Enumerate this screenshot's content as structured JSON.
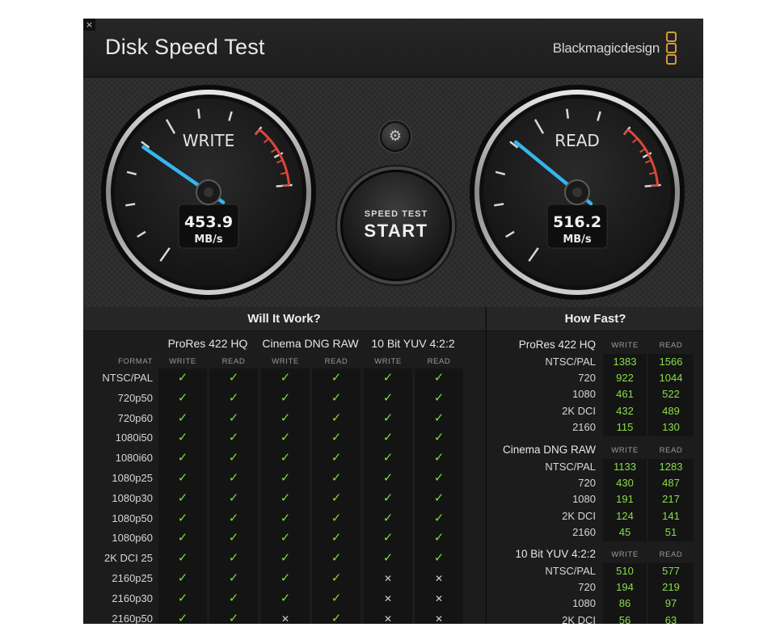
{
  "window": {
    "close_glyph": "×",
    "title": "Disk Speed Test",
    "brand": "Blackmagicdesign"
  },
  "gauges": {
    "write": {
      "label": "WRITE",
      "value": "453.9",
      "unit": "MB/s",
      "needle_fraction": 0.39
    },
    "read": {
      "label": "READ",
      "value": "516.2",
      "unit": "MB/s",
      "needle_fraction": 0.41
    }
  },
  "controls": {
    "settings_icon": "gear-icon",
    "settings_glyph": "⚙",
    "start_top": "SPEED TEST",
    "start_main": "START"
  },
  "will_it_work": {
    "title": "Will It Work?",
    "format_label": "FORMAT",
    "groups": [
      "ProRes 422 HQ",
      "Cinema DNG RAW",
      "10 Bit YUV 4:2:2"
    ],
    "subheaders": [
      "WRITE",
      "READ"
    ],
    "rows": [
      {
        "format": "NTSC/PAL",
        "marks": [
          1,
          1,
          1,
          1,
          1,
          1
        ]
      },
      {
        "format": "720p50",
        "marks": [
          1,
          1,
          1,
          1,
          1,
          1
        ]
      },
      {
        "format": "720p60",
        "marks": [
          1,
          1,
          1,
          1,
          1,
          1
        ]
      },
      {
        "format": "1080i50",
        "marks": [
          1,
          1,
          1,
          1,
          1,
          1
        ]
      },
      {
        "format": "1080i60",
        "marks": [
          1,
          1,
          1,
          1,
          1,
          1
        ]
      },
      {
        "format": "1080p25",
        "marks": [
          1,
          1,
          1,
          1,
          1,
          1
        ]
      },
      {
        "format": "1080p30",
        "marks": [
          1,
          1,
          1,
          1,
          1,
          1
        ]
      },
      {
        "format": "1080p50",
        "marks": [
          1,
          1,
          1,
          1,
          1,
          1
        ]
      },
      {
        "format": "1080p60",
        "marks": [
          1,
          1,
          1,
          1,
          1,
          1
        ]
      },
      {
        "format": "2K DCI 25",
        "marks": [
          1,
          1,
          1,
          1,
          1,
          1
        ]
      },
      {
        "format": "2160p25",
        "marks": [
          1,
          1,
          1,
          1,
          0,
          0
        ]
      },
      {
        "format": "2160p30",
        "marks": [
          1,
          1,
          1,
          1,
          0,
          0
        ]
      },
      {
        "format": "2160p50",
        "marks": [
          1,
          1,
          0,
          1,
          0,
          0
        ]
      }
    ],
    "check_glyph": "✓",
    "cross_glyph": "✕"
  },
  "how_fast": {
    "title": "How Fast?",
    "subheaders": [
      "WRITE",
      "READ"
    ],
    "groups": [
      {
        "name": "ProRes 422 HQ",
        "rows": [
          {
            "label": "NTSC/PAL",
            "write": "1383",
            "read": "1566"
          },
          {
            "label": "720",
            "write": "922",
            "read": "1044"
          },
          {
            "label": "1080",
            "write": "461",
            "read": "522"
          },
          {
            "label": "2K DCI",
            "write": "432",
            "read": "489"
          },
          {
            "label": "2160",
            "write": "115",
            "read": "130"
          }
        ]
      },
      {
        "name": "Cinema DNG RAW",
        "rows": [
          {
            "label": "NTSC/PAL",
            "write": "1133",
            "read": "1283"
          },
          {
            "label": "720",
            "write": "430",
            "read": "487"
          },
          {
            "label": "1080",
            "write": "191",
            "read": "217"
          },
          {
            "label": "2K DCI",
            "write": "124",
            "read": "141"
          },
          {
            "label": "2160",
            "write": "45",
            "read": "51"
          }
        ]
      },
      {
        "name": "10 Bit YUV 4:2:2",
        "rows": [
          {
            "label": "NTSC/PAL",
            "write": "510",
            "read": "577"
          },
          {
            "label": "720",
            "write": "194",
            "read": "219"
          },
          {
            "label": "1080",
            "write": "86",
            "read": "97"
          },
          {
            "label": "2K DCI",
            "write": "56",
            "read": "63"
          }
        ]
      }
    ]
  },
  "colors": {
    "needle": "#34b6f0",
    "redline": "#d9473a",
    "check": "#7dde3e",
    "number": "#88de48",
    "brand_logo": "#d39b3c"
  }
}
